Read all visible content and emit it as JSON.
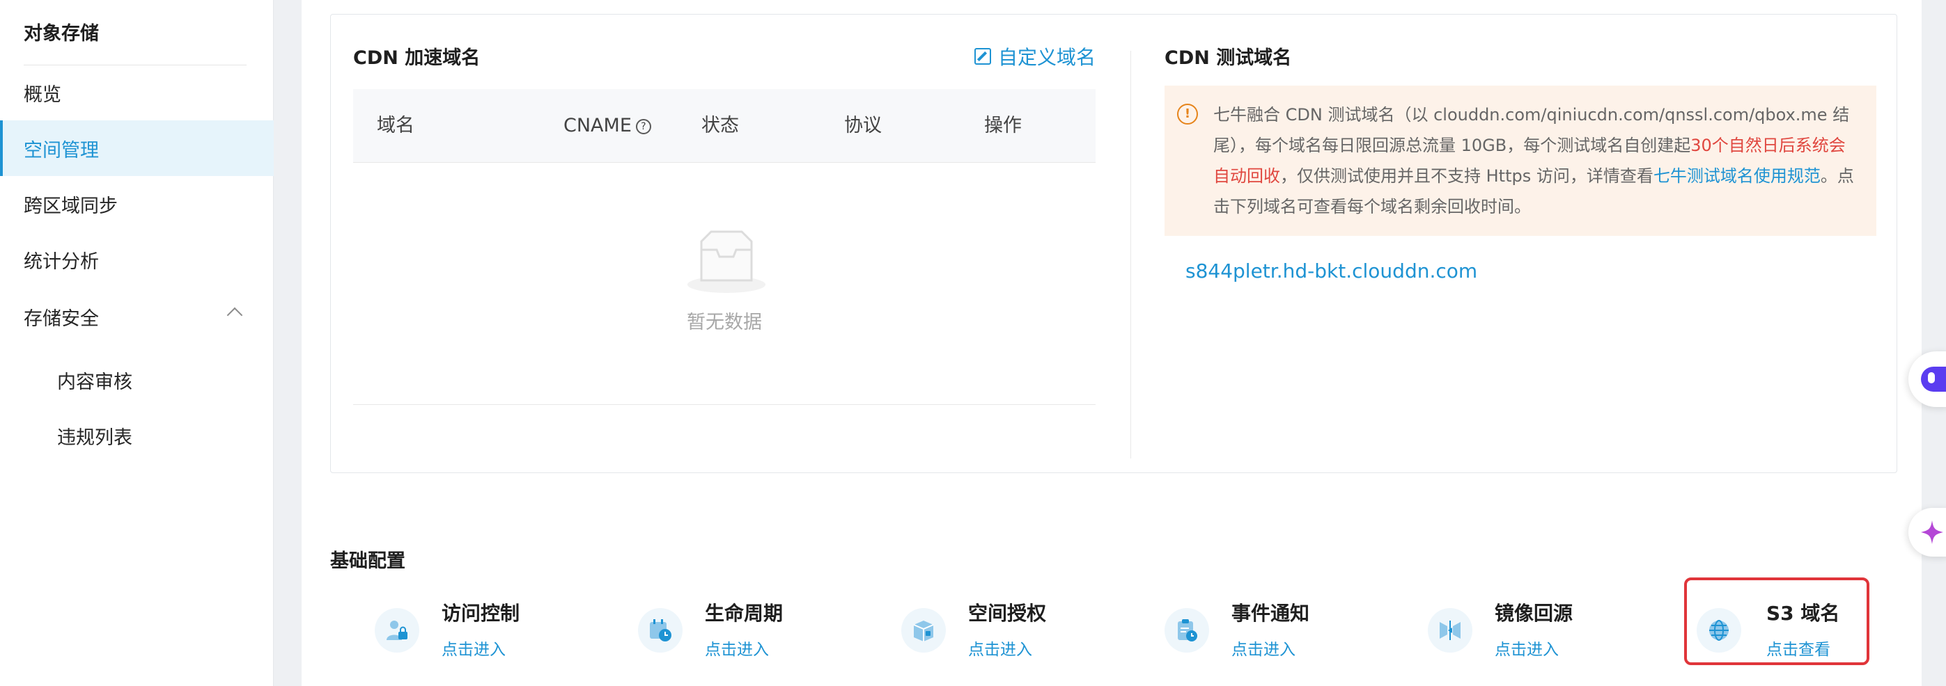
{
  "sidebar": {
    "title": "对象存储",
    "items": [
      {
        "label": "概览"
      },
      {
        "label": "空间管理"
      },
      {
        "label": "跨区域同步"
      },
      {
        "label": "统计分析"
      },
      {
        "label": "存储安全"
      },
      {
        "label": "内容审核"
      },
      {
        "label": "违规列表"
      }
    ]
  },
  "cdn": {
    "title": "CDN 加速域名",
    "custom_link": "自定义域名",
    "columns": [
      "域名",
      "CNAME",
      "状态",
      "协议",
      "操作"
    ],
    "empty_text": "暂无数据"
  },
  "test_domain": {
    "title": "CDN 测试域名",
    "notice": {
      "part1": "七牛融合 CDN 测试域名（以 clouddn.com/qiniucdn.com/qnssl.com/qbox.me 结尾），每个域名每日限回源总流量 10GB，每个测试域名自创建起",
      "red": "30个自然日后系统会自动回收",
      "part2": "，仅供测试使用并且不支持 Https 访问，详情查看",
      "link": "七牛测试域名使用规范",
      "part3": "。点击下列域名可查看每个域名剩余回收时间。"
    },
    "domain": "s844pletr.hd-bkt.clouddn.com"
  },
  "base_config": {
    "title": "基础配置",
    "items": [
      {
        "name": "访问控制",
        "link": "点击进入",
        "icon": "user-lock-icon"
      },
      {
        "name": "生命周期",
        "link": "点击进入",
        "icon": "calendar-clock-icon"
      },
      {
        "name": "空间授权",
        "link": "点击进入",
        "icon": "box-icon"
      },
      {
        "name": "事件通知",
        "link": "点击进入",
        "icon": "clipboard-clock-icon"
      },
      {
        "name": "镜像回源",
        "link": "点击进入",
        "icon": "mirror-icon"
      },
      {
        "name": "S3 域名",
        "link": "点击查看",
        "icon": "globe-icon"
      }
    ]
  },
  "colors": {
    "accent": "#1e93d3",
    "warning_bg": "#fdf2e9",
    "warning": "#e6841a",
    "danger": "#e0473f",
    "highlight": "#e0353a"
  }
}
